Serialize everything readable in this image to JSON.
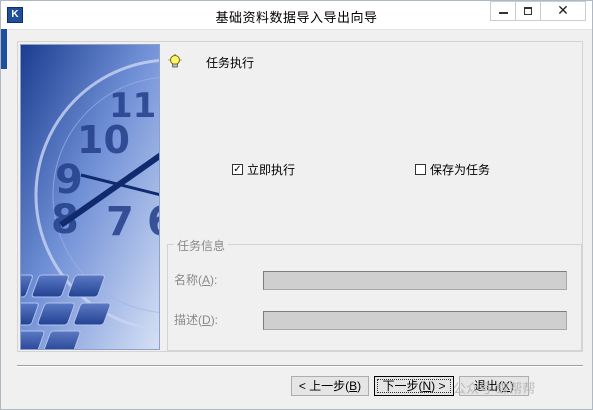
{
  "window": {
    "title": "基础资料数据导入导出向导",
    "controls": {
      "minimize": "—",
      "maximize": "□",
      "close": "✕"
    }
  },
  "step": {
    "heading": "任务执行",
    "icon": "lightbulb-icon"
  },
  "options": {
    "run_now": {
      "label": "立即执行",
      "checked": true
    },
    "save_as_task": {
      "label": "保存为任务",
      "checked": false
    }
  },
  "task_info": {
    "legend": "任务信息",
    "name": {
      "label": "名称",
      "accel": "A",
      "value": ""
    },
    "description": {
      "label": "描述",
      "accel": "D",
      "value": ""
    }
  },
  "buttons": {
    "back": {
      "label": "< 上一步",
      "accel": "B"
    },
    "next": {
      "label": "下一步",
      "accel": "N",
      "suffix": " >"
    },
    "exit": {
      "label": "退出",
      "accel": "X"
    }
  },
  "watermark": "公众号·蝶帮帮",
  "colors": {
    "art_dark": "#1c3d8f",
    "art_light": "#d8e2f6",
    "disabled_field": "#cfcfcf"
  }
}
